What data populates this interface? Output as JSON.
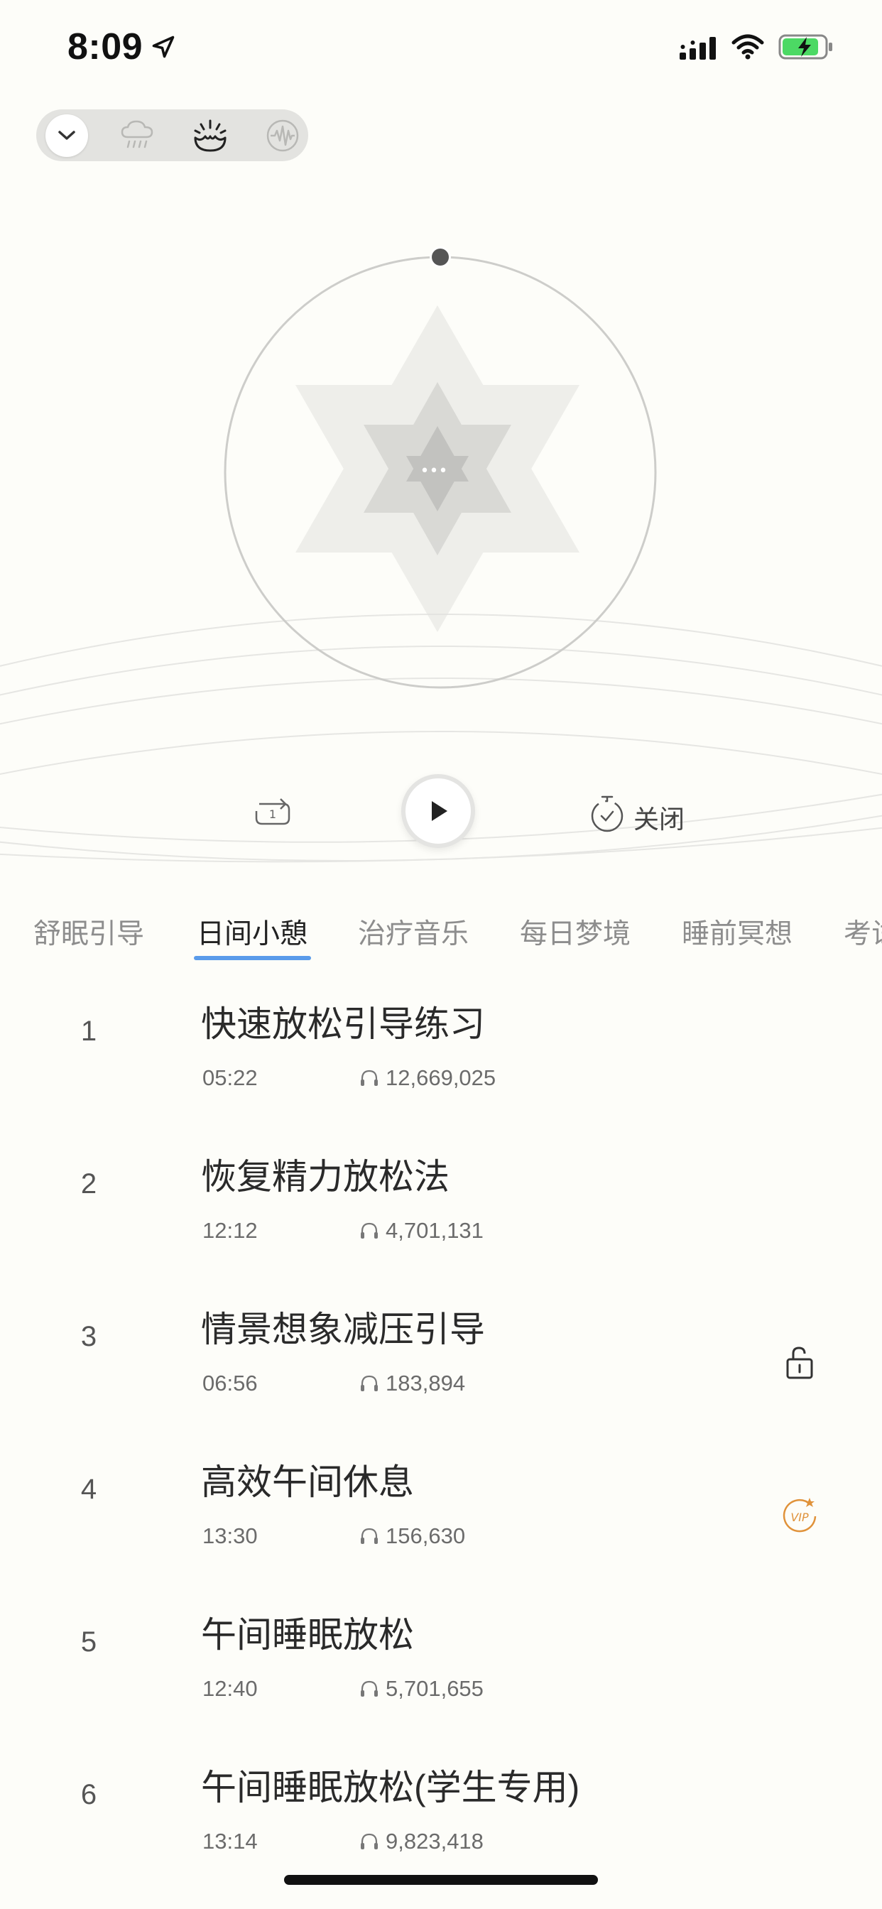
{
  "status": {
    "time": "8:09",
    "icons": [
      "location-arrow-icon",
      "signal-icon",
      "wifi-icon",
      "battery-charging-icon"
    ]
  },
  "sound_modes": {
    "items": [
      {
        "icon": "chevron-down-icon",
        "active": true
      },
      {
        "icon": "rain-cloud-icon",
        "active": false
      },
      {
        "icon": "campfire-icon",
        "active": false
      },
      {
        "icon": "waveform-icon",
        "active": false
      }
    ]
  },
  "player": {
    "orb_more_label": "•••",
    "timer_label": "关闭",
    "loop_count": "1"
  },
  "tabs": [
    {
      "label": "舒眠引导"
    },
    {
      "label": "日间小憩"
    },
    {
      "label": "治疗音乐"
    },
    {
      "label": "每日梦境"
    },
    {
      "label": "睡前冥想"
    },
    {
      "label": "考试"
    }
  ],
  "active_tab_index": 1,
  "tracks": [
    {
      "rank": "1",
      "title": "快速放松引导练习",
      "duration": "05:22",
      "plays": "12,669,025",
      "badge": ""
    },
    {
      "rank": "2",
      "title": "恢复精力放松法",
      "duration": "12:12",
      "plays": "4,701,131",
      "badge": ""
    },
    {
      "rank": "3",
      "title": "情景想象减压引导",
      "duration": "06:56",
      "plays": "183,894",
      "badge": "unlock-icon"
    },
    {
      "rank": "4",
      "title": "高效午间休息",
      "duration": "13:30",
      "plays": "156,630",
      "badge": "vip-icon"
    },
    {
      "rank": "5",
      "title": "午间睡眠放松",
      "duration": "12:40",
      "plays": "5,701,655",
      "badge": ""
    },
    {
      "rank": "6",
      "title": "午间睡眠放松(学生专用)",
      "duration": "13:14",
      "plays": "9,823,418",
      "badge": ""
    }
  ],
  "colors": {
    "background": "#FDFDF9",
    "tab_active_underline": "#5A9BEA",
    "vip": "#E0923A"
  }
}
